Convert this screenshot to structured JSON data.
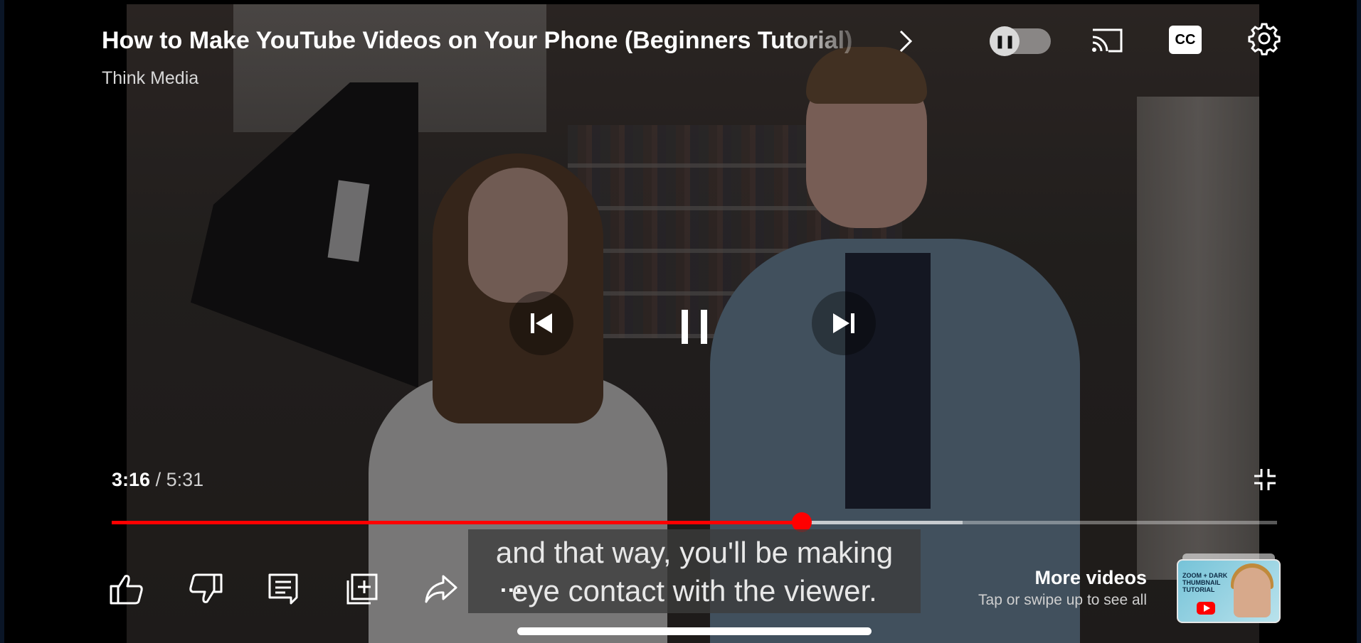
{
  "video": {
    "title": "How to Make YouTube Videos on Your Phone (Beginners Tutorial)",
    "channel": "Think Media"
  },
  "playback": {
    "current_time": "3:16",
    "separator": "/",
    "duration": "5:31",
    "played_fraction": 0.592,
    "buffered_fraction": 0.73,
    "state": "playing"
  },
  "captions": {
    "lines": [
      "and that way, you'll be making",
      "eye contact with the viewer."
    ]
  },
  "top_controls": {
    "autoplay": "on",
    "cc_label": "CC"
  },
  "actions": {
    "more_label": "..."
  },
  "more_videos": {
    "title": "More videos",
    "subtitle": "Tap or swipe up to see all",
    "thumbnail_text": "ZOOM + DARK THUMBNAIL TUTORIAL"
  },
  "colors": {
    "progress_played": "#ff0000",
    "background": "#000000"
  }
}
